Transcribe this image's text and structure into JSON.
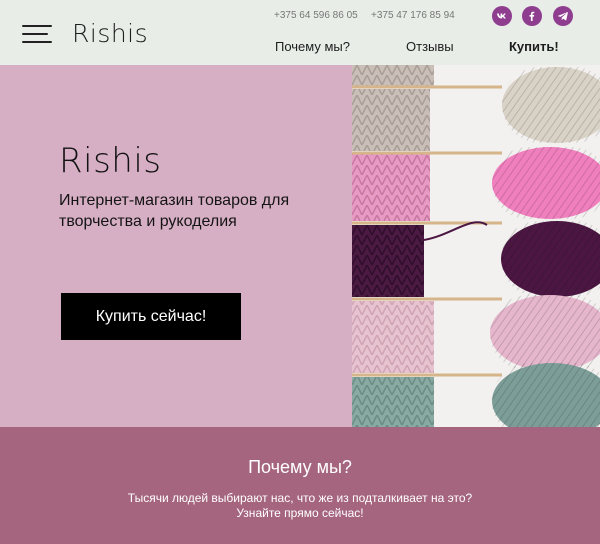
{
  "header": {
    "logo": "Rishis",
    "phones": [
      "+375 64 596 86 05",
      "+375 47 176 85 94"
    ],
    "socials": [
      "vk-icon",
      "facebook-icon",
      "telegram-icon"
    ],
    "nav": {
      "why": "Почему мы?",
      "reviews": "Отзывы",
      "buy": "Купить!"
    }
  },
  "hero": {
    "brand": "Rishis",
    "subtitle": "Интернет-магазин товаров для творчества и рукоделия",
    "button": "Купить сейчас!"
  },
  "why": {
    "title": "Почему мы?",
    "text_line1": "Тысячи людей выбирают нас, что же из подталкивает на это?",
    "text_line2": "Узнайте прямо сейчас!"
  },
  "colors": {
    "header_bg": "#e8ede8",
    "hero_bg": "#d7afc5",
    "section_bg": "#a5657f",
    "accent": "#8f3d8f"
  }
}
